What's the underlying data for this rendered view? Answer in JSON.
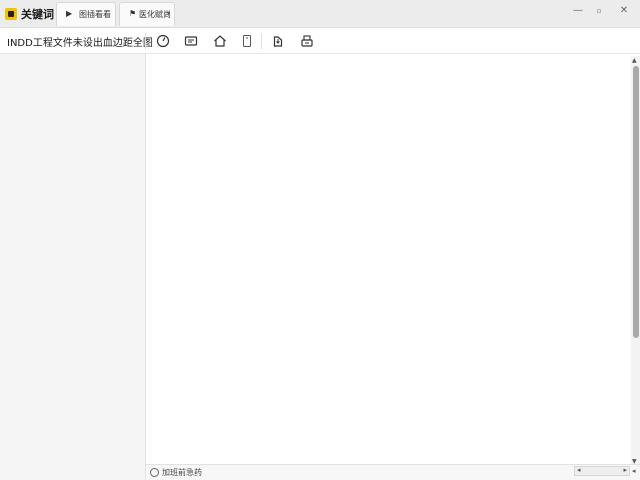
{
  "app": {
    "title": "关键词",
    "logo": "app-logo"
  },
  "tabs": [
    {
      "label": "图插看看",
      "icon": "play-icon"
    },
    {
      "label": "医化赋尚",
      "icon": "flag-icon",
      "has_dropdown": true
    }
  ],
  "window_controls": {
    "minimize": "—",
    "restore": "▫",
    "close": "✕"
  },
  "document": {
    "title": "INDD工程文件未设出血边距全图"
  },
  "toolbar": {
    "tools": [
      {
        "icon": "gauge-icon"
      },
      {
        "icon": "card-icon"
      },
      {
        "icon": "home-icon"
      },
      {
        "icon": "phone-icon"
      },
      {
        "icon": "export-icon"
      },
      {
        "icon": "printer-icon"
      }
    ]
  },
  "statusbar": {
    "text": "加班前急药",
    "icon": "status-icon"
  },
  "scrollbar": {
    "up": "▲",
    "down": "▼",
    "left": "◂",
    "right": "▸",
    "zoom": "◂"
  },
  "colors": {
    "accent": "#f5c000",
    "chrome": "#ececec",
    "sidebar": "#f5f5f5"
  }
}
